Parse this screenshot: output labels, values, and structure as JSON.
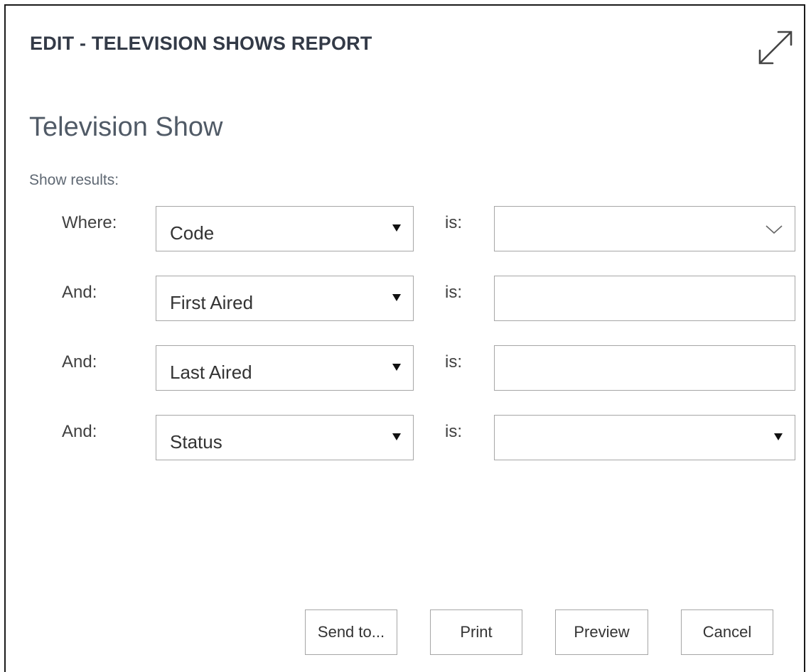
{
  "header": {
    "title": "EDIT - TELEVISION SHOWS REPORT",
    "expand_icon": "expand-diagonal-arrows-icon"
  },
  "page": {
    "title": "Television Show",
    "section_label": "Show results:"
  },
  "filters": [
    {
      "label": "Where:",
      "field": "Code",
      "operator": "is:",
      "value": "",
      "value_control": "combo-chevron"
    },
    {
      "label": "And:",
      "field": "First Aired",
      "operator": "is:",
      "value": "",
      "value_control": "text"
    },
    {
      "label": "And:",
      "field": "Last Aired",
      "operator": "is:",
      "value": "",
      "value_control": "text"
    },
    {
      "label": "And:",
      "field": "Status",
      "operator": "is:",
      "value": "",
      "value_control": "dropdown-caret"
    }
  ],
  "buttons": {
    "send_to": "Send to...",
    "print": "Print",
    "preview": "Preview",
    "cancel": "Cancel"
  }
}
